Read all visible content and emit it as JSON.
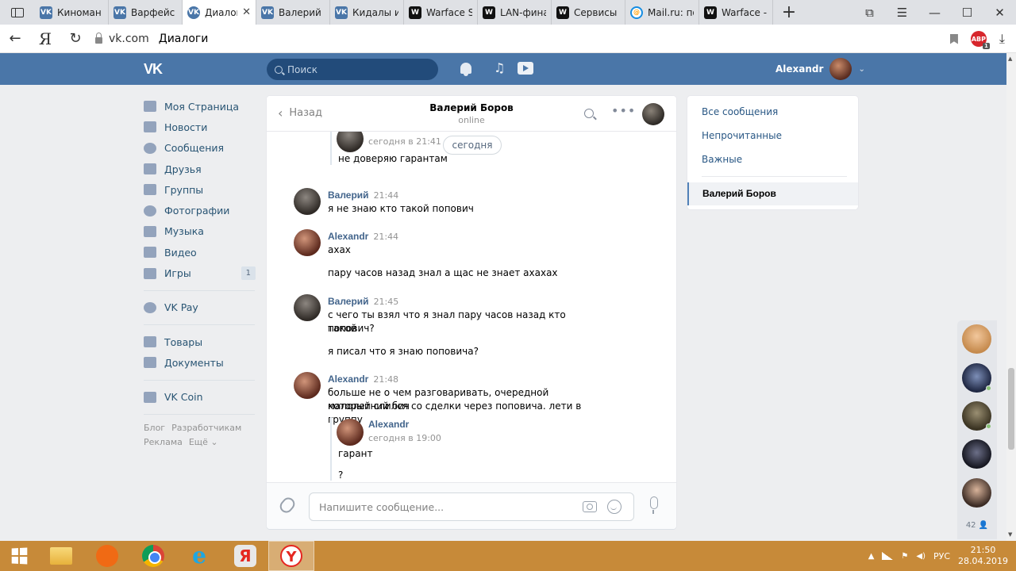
{
  "browser": {
    "tabs": [
      {
        "label": "Киноман",
        "fav": "vk",
        "active": false
      },
      {
        "label": "Варфейс",
        "fav": "vk",
        "active": false
      },
      {
        "label": "Диалог",
        "fav": "vkmsg",
        "active": true
      },
      {
        "label": "Валерий Б",
        "fav": "vk",
        "active": false
      },
      {
        "label": "Кидалы и",
        "fav": "vk",
        "active": false
      },
      {
        "label": "Warface S",
        "fav": "wf",
        "active": false
      },
      {
        "label": "LAN-фина",
        "fav": "wf",
        "active": false
      },
      {
        "label": "Сервисы",
        "fav": "wf",
        "active": false
      },
      {
        "label": "Mail.ru: по",
        "fav": "mail",
        "active": false
      },
      {
        "label": "Warface -",
        "fav": "wf",
        "active": false
      }
    ],
    "yandex_logo": "Я",
    "address_domain": "vk.com",
    "address_path": "Диалоги",
    "adblock_label": "ABP",
    "adblock_count": "1"
  },
  "vk": {
    "logo": "VK",
    "search_placeholder": "Поиск",
    "user_name": "Alexandr",
    "menu": [
      {
        "label": "Моя Страница",
        "icon": "home-icon"
      },
      {
        "label": "Новости",
        "icon": "news-icon"
      },
      {
        "label": "Сообщения",
        "icon": "messages-icon"
      },
      {
        "label": "Друзья",
        "icon": "friends-icon"
      },
      {
        "label": "Группы",
        "icon": "groups-icon"
      },
      {
        "label": "Фотографии",
        "icon": "camera-icon"
      },
      {
        "label": "Музыка",
        "icon": "music-icon"
      },
      {
        "label": "Видео",
        "icon": "video-icon"
      },
      {
        "label": "Игры",
        "icon": "gamepad-icon",
        "badge": "1"
      }
    ],
    "menu2": [
      {
        "label": "VK Pay",
        "icon": "vkpay-icon"
      }
    ],
    "menu3": [
      {
        "label": "Товары",
        "icon": "shopping-bag-icon"
      },
      {
        "label": "Документы",
        "icon": "document-icon"
      }
    ],
    "menu4": [
      {
        "label": "VK Coin",
        "icon": "apps-icon"
      }
    ],
    "footer": {
      "blog": "Блог",
      "dev": "Разработчикам",
      "ads": "Реклама",
      "more": "Ещё ⌄"
    }
  },
  "chat": {
    "back_label": "Назад",
    "peer_name": "Валерий Боров",
    "peer_status": "online",
    "top_forward": {
      "date": "сегодня в 21:41",
      "text": "не доверяю гарантам"
    },
    "date_pill": "сегодня",
    "messages": [
      {
        "author": "Валерий",
        "time": "21:44",
        "lines": [
          "я не знаю кто такой попович"
        ]
      },
      {
        "author": "Alexandr",
        "time": "21:44",
        "lines": [
          "ахах",
          "пару часов назад знал а щас не знает ахахах"
        ]
      },
      {
        "author": "Валерий",
        "time": "21:45",
        "lines": [
          "с чего ты взял что я знал пару часов назад кто такой",
          "попович?",
          "я писал что я знаю поповича?"
        ]
      },
      {
        "author": "Alexandr",
        "time": "21:48",
        "lines": [
          "больше не о чем разговаривать, очередной малолетний бич",
          "который слился со сделки через поповича. лети в группу"
        ]
      }
    ],
    "bottom_forward": {
      "name": "Alexandr",
      "date": "сегодня в 19:00",
      "lines": [
        "гарант",
        "?"
      ]
    },
    "input_placeholder": "Напишите сообщение..."
  },
  "filters": {
    "all": "Все сообщения",
    "unread": "Непрочитанные",
    "important": "Важные",
    "active_dialog": "Валерий Боров"
  },
  "friends_sidebar": {
    "count": "42 👤"
  },
  "taskbar": {
    "lang": "РУС",
    "time": "21:50",
    "date": "28.04.2019"
  }
}
